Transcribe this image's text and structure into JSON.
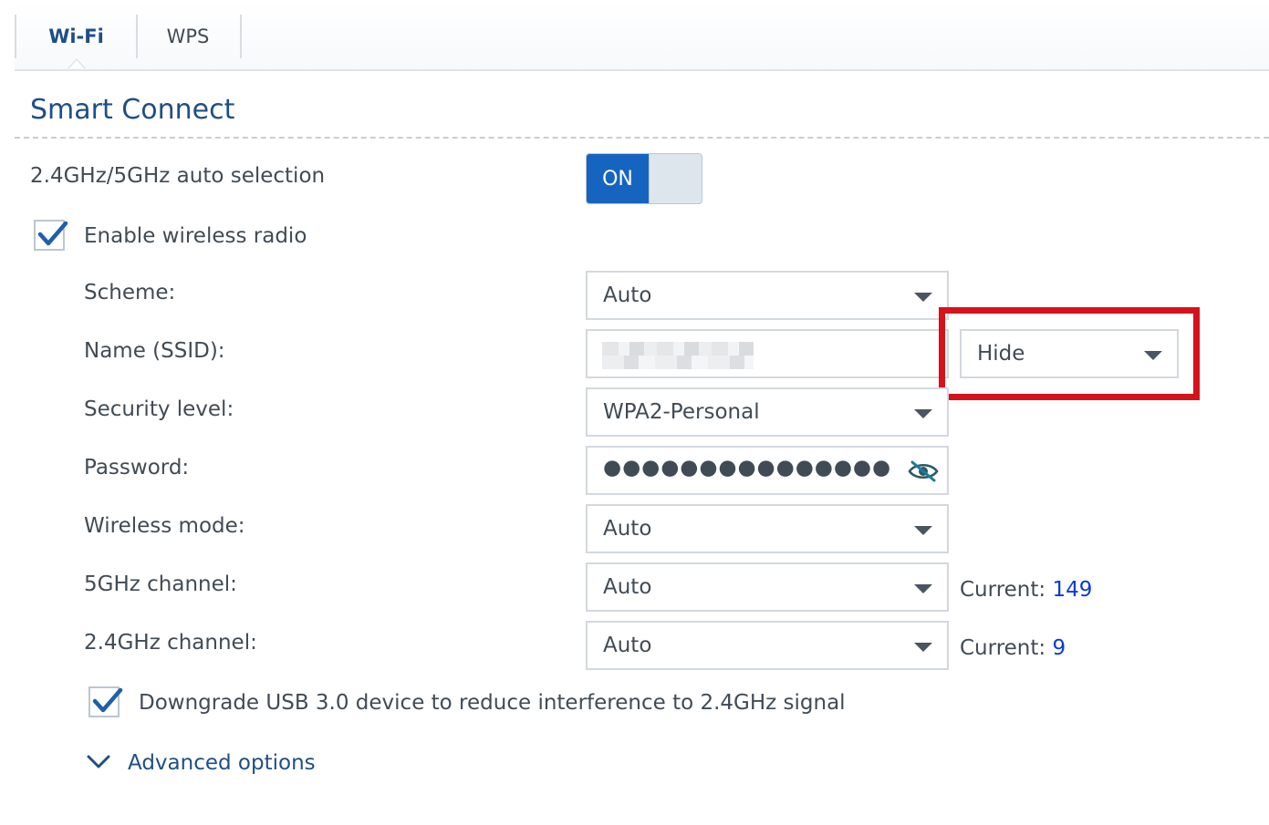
{
  "tabs": [
    {
      "label": "Wi-Fi",
      "active": true
    },
    {
      "label": "WPS",
      "active": false
    }
  ],
  "section": {
    "title": "Smart Connect"
  },
  "auto_selection": {
    "label": "2.4GHz/5GHz auto selection",
    "toggle_text": "ON",
    "state": "on"
  },
  "enable_radio": {
    "label": "Enable wireless radio",
    "checked": true
  },
  "form": {
    "scheme": {
      "label": "Scheme:",
      "value": "Auto"
    },
    "ssid": {
      "label": "Name (SSID):",
      "visibility": "Hide"
    },
    "security": {
      "label": "Security level:",
      "value": "WPA2-Personal"
    },
    "password": {
      "label": "Password:",
      "masked": "●●●●●●●●●●●●●●●"
    },
    "wireless_mode": {
      "label": "Wireless mode:",
      "value": "Auto"
    },
    "channel_5g": {
      "label": "5GHz channel:",
      "value": "Auto",
      "current_label": "Current:",
      "current_value": "149"
    },
    "channel_24g": {
      "label": "2.4GHz channel:",
      "value": "Auto",
      "current_label": "Current:",
      "current_value": "9"
    }
  },
  "usb_downgrade": {
    "label": "Downgrade USB 3.0 device to reduce interference to 2.4GHz signal",
    "checked": true
  },
  "advanced": {
    "label": "Advanced options"
  },
  "colors": {
    "accent": "#1565c0",
    "title": "#1f4e86",
    "highlight": "#d6121b",
    "current_value": "#0b3ad6"
  },
  "icons": {
    "password_toggle": "eye-slash-icon",
    "advanced": "chevron-down-icon",
    "select": "caret-down-icon"
  }
}
